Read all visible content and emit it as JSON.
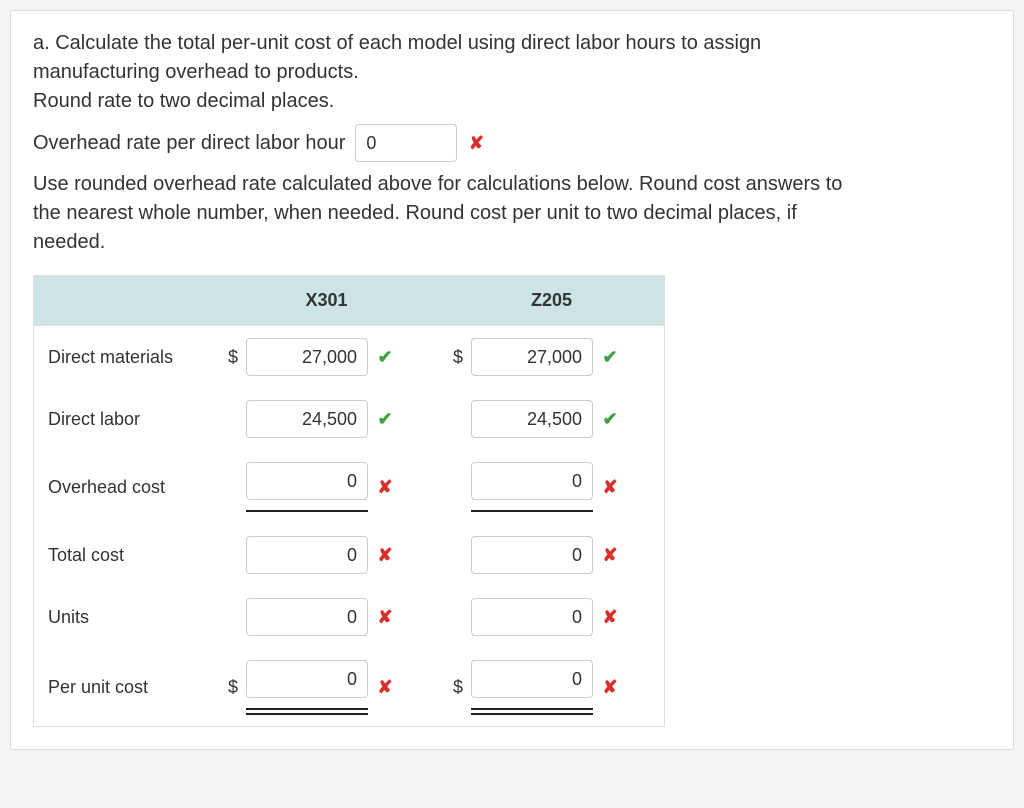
{
  "question": {
    "prompt_line1": "a. Calculate the total per-unit cost of each model using direct labor hours to assign",
    "prompt_line2": "manufacturing overhead to products.",
    "prompt_line3": "Round rate to two decimal places.",
    "overhead_label": "Overhead rate per direct labor hour",
    "overhead_value": "0",
    "overhead_mark": "wrong",
    "note_line1": "Use rounded overhead rate calculated above for calculations below. Round cost answers to",
    "note_line2": "the nearest whole number, when needed. Round cost per unit to two decimal places, if",
    "note_line3": "needed."
  },
  "table": {
    "col1": "X301",
    "col2": "Z205",
    "rows": [
      {
        "label": "Direct materials",
        "prefix": "$",
        "v1": "27,000",
        "m1": "correct",
        "v2": "27,000",
        "m2": "correct"
      },
      {
        "label": "Direct labor",
        "prefix": "",
        "v1": "24,500",
        "m1": "correct",
        "v2": "24,500",
        "m2": "correct"
      },
      {
        "label": "Overhead cost",
        "prefix": "",
        "v1": "0",
        "m1": "wrong",
        "v2": "0",
        "m2": "wrong",
        "rule": "single"
      },
      {
        "label": "Total cost",
        "prefix": "",
        "v1": "0",
        "m1": "wrong",
        "v2": "0",
        "m2": "wrong"
      },
      {
        "label": "Units",
        "prefix": "",
        "v1": "0",
        "m1": "wrong",
        "v2": "0",
        "m2": "wrong"
      },
      {
        "label": "Per unit cost",
        "prefix": "$",
        "v1": "0",
        "m1": "wrong",
        "v2": "0",
        "m2": "wrong",
        "rule": "double"
      }
    ]
  },
  "glyphs": {
    "correct": "✔",
    "wrong": "✘"
  }
}
